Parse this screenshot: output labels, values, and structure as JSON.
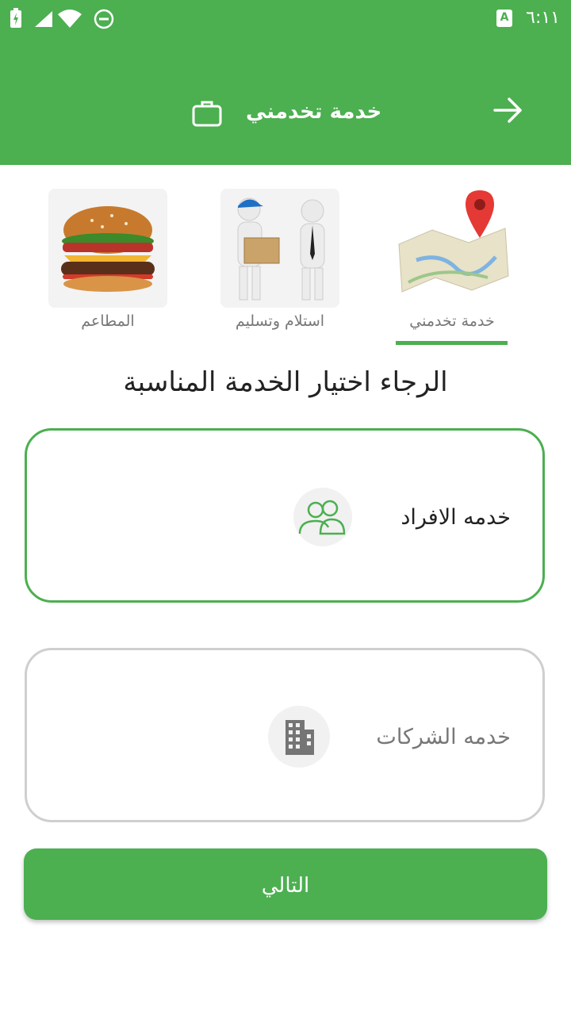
{
  "status_bar": {
    "time": "٦:١١",
    "keyboard_badge": "A"
  },
  "app_bar": {
    "title": "خدمة تخدمني"
  },
  "categories": [
    {
      "label": "المطاعم",
      "icon": "burger-icon"
    },
    {
      "label": "استلام وتسليم",
      "icon": "delivery-people-icon"
    },
    {
      "label": "خدمة تخدمني",
      "icon": "map-pin-icon",
      "selected": true
    }
  ],
  "heading": "الرجاء اختيار الخدمة المناسبة",
  "options": [
    {
      "label": "خدمه الافراد",
      "icon": "people-icon",
      "selected": true
    },
    {
      "label": "خدمه الشركات",
      "icon": "building-icon",
      "selected": false
    }
  ],
  "next_button": "التالي",
  "colors": {
    "primary": "#4caf50",
    "unselected_border": "#cfcfcf"
  }
}
